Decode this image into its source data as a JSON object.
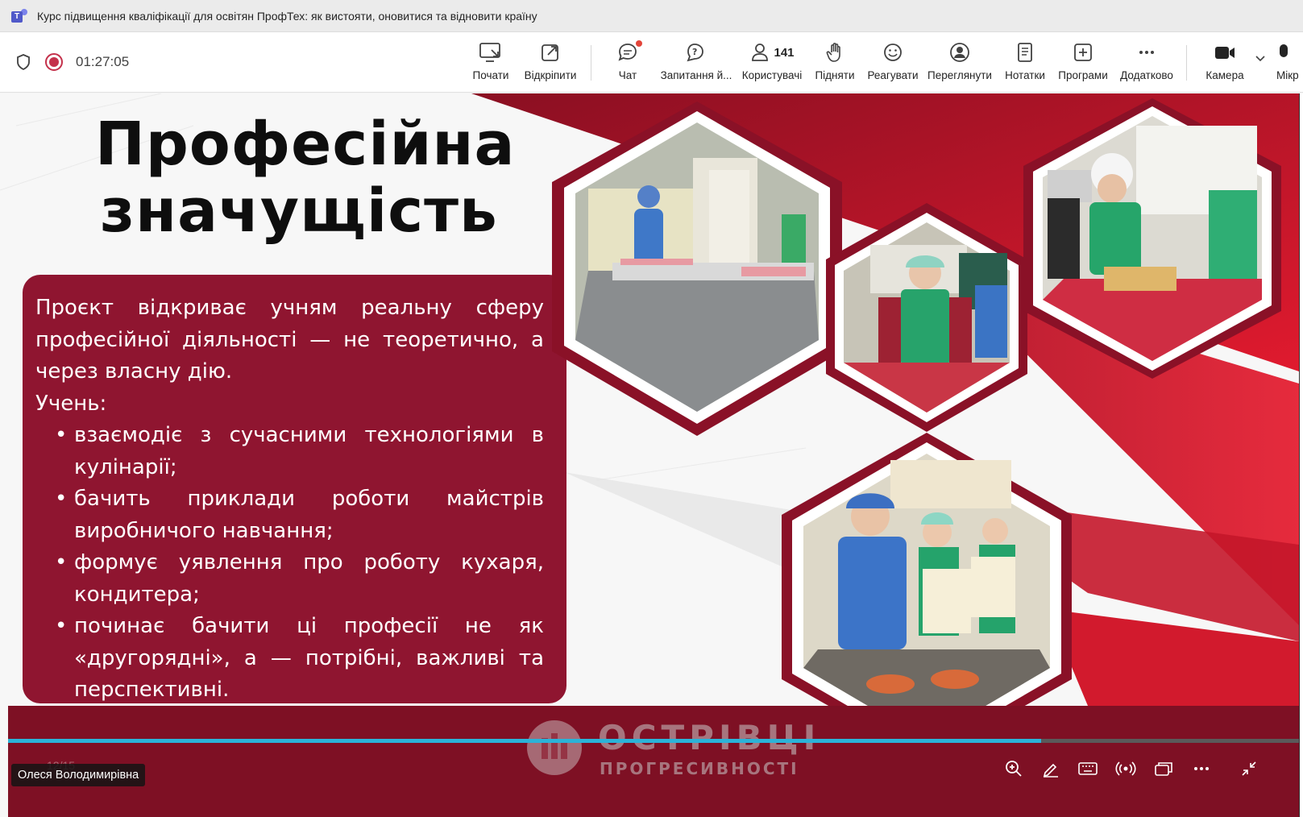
{
  "window": {
    "title": "Курс підвищення кваліфікації для освітян ПрофТех: як вистояти, оновитися та відновити країну",
    "app_icon": "teams-icon"
  },
  "meeting": {
    "elapsed": "01:27:05",
    "participants_count": "141"
  },
  "toolbar": {
    "share": "Почати",
    "popout": "Відкріпити",
    "chat": "Чат",
    "qa": "Запитання й...",
    "people": "Користувачі",
    "raise": "Підняти",
    "react": "Реагувати",
    "view": "Переглянути",
    "notes": "Нотатки",
    "apps": "Програми",
    "more": "Додатково",
    "camera": "Камера",
    "mic": "Мікр"
  },
  "slide": {
    "title_line1": "Професійна",
    "title_line2": "значущість",
    "paragraph": "Проєкт відкриває учням реальну сферу професійної діяльності — не теоретично, а через власну дію.",
    "student_label": "Учень:",
    "bullets": [
      "взаємодіє з сучасними технологіями в кулінарії;",
      "бачить приклади роботи майстрів виробничого навчання;",
      "формує уявлення про роботу кухаря, кондитера;",
      "починає бачити ці професії не як «другорядні», а — потрібні, важливі та перспективні."
    ],
    "logo_line1": "ОСТРІВЦІ",
    "logo_line2": "ПРОГРЕСИВНОСТІ",
    "page_indicator": "12/15"
  },
  "presenter": {
    "name": "Олеся Володимирівна"
  },
  "playback": {
    "progress_fraction": 0.8
  },
  "colors": {
    "slide_red": "#8f1530",
    "bright_red": "#d9162d",
    "progress": "#2bb3d8",
    "record": "#c4314b"
  }
}
